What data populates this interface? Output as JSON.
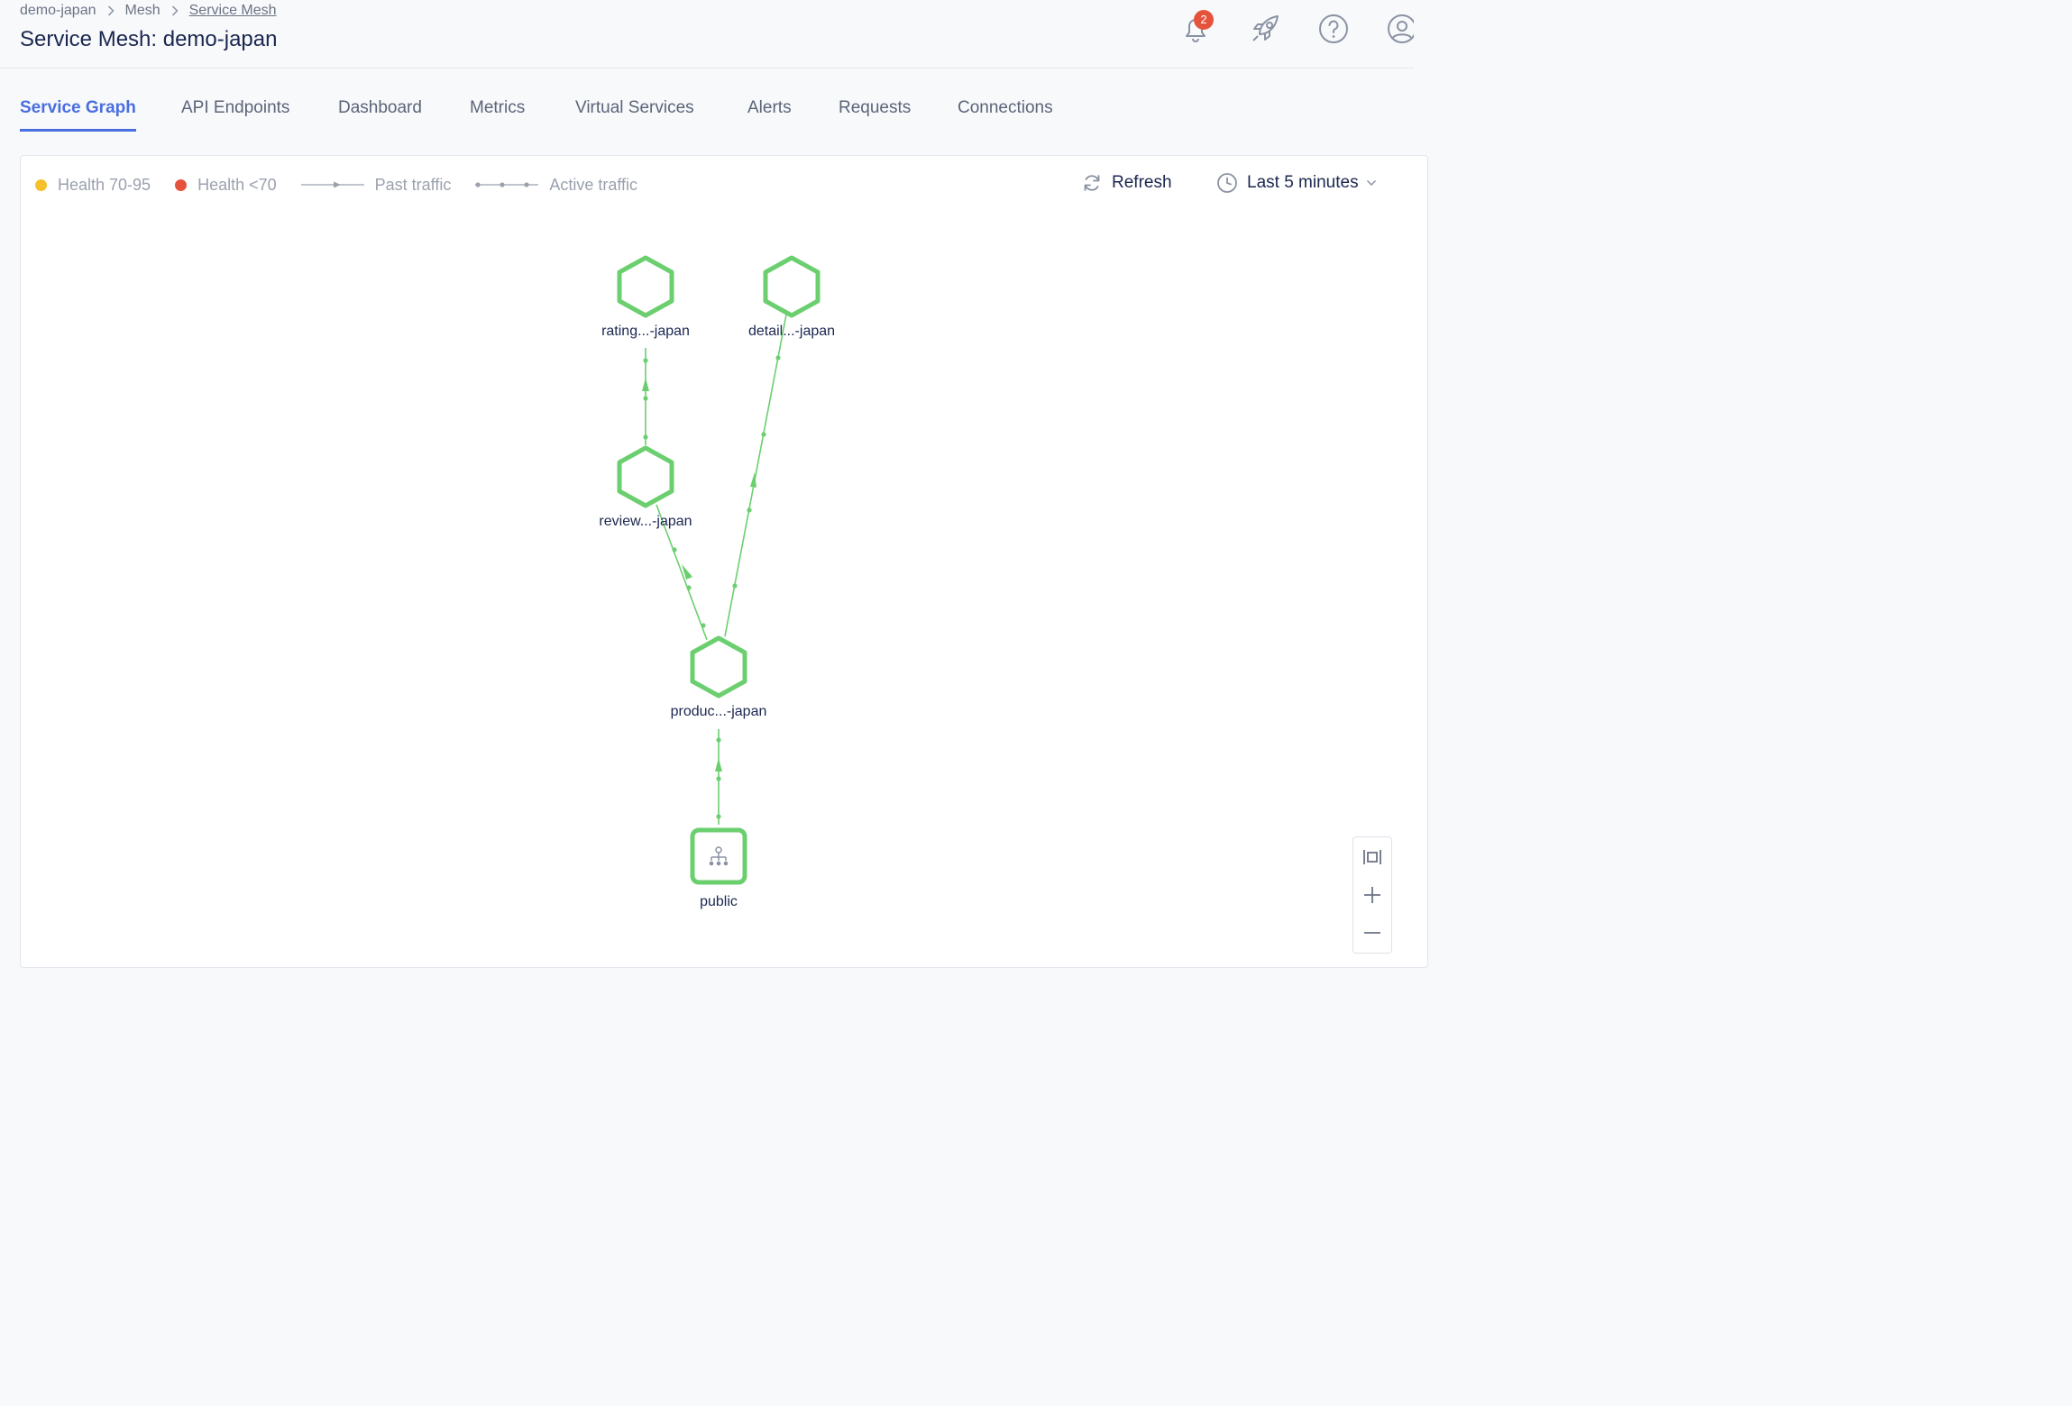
{
  "breadcrumb": {
    "items": [
      "demo-japan",
      "Mesh"
    ],
    "current": "Service Mesh"
  },
  "header": {
    "title": "Service Mesh: demo-japan",
    "notification_count": "2"
  },
  "tabs": [
    {
      "label": "Service Graph",
      "active": true
    },
    {
      "label": "API Endpoints"
    },
    {
      "label": "Dashboard"
    },
    {
      "label": "Metrics"
    },
    {
      "label": "Virtual Services"
    },
    {
      "label": "Alerts"
    },
    {
      "label": "Requests"
    },
    {
      "label": "Connections"
    }
  ],
  "legend": {
    "health_warn": "Health 70-95",
    "health_bad": "Health <70",
    "past_traffic": "Past traffic",
    "active_traffic": "Active traffic"
  },
  "toolbar": {
    "refresh_label": "Refresh",
    "time_range": "Last 5 minutes"
  },
  "graph": {
    "nodes": [
      {
        "id": "ratings",
        "label": "rating...-japan",
        "shape": "hexagon"
      },
      {
        "id": "details",
        "label": "detail...-japan",
        "shape": "hexagon"
      },
      {
        "id": "reviews",
        "label": "review...-japan",
        "shape": "hexagon"
      },
      {
        "id": "productpage",
        "label": "produc...-japan",
        "shape": "hexagon"
      },
      {
        "id": "public",
        "label": "public",
        "shape": "gateway"
      }
    ],
    "edges": [
      {
        "from": "public",
        "to": "productpage"
      },
      {
        "from": "productpage",
        "to": "reviews"
      },
      {
        "from": "productpage",
        "to": "details"
      },
      {
        "from": "reviews",
        "to": "ratings"
      }
    ]
  },
  "colors": {
    "accent": "#4a6ee0",
    "healthy": "#6bcf6f",
    "health_warn": "#f5c02d",
    "health_bad": "#e5533d",
    "badge": "#e5533d"
  },
  "icons": {
    "notifications": "bell-icon",
    "launch": "rocket-icon",
    "help": "help-icon",
    "profile": "user-icon",
    "refresh": "refresh-icon",
    "time": "clock-icon",
    "fit": "fit-to-screen-icon",
    "zoom_in": "plus-icon",
    "zoom_out": "minus-icon"
  }
}
